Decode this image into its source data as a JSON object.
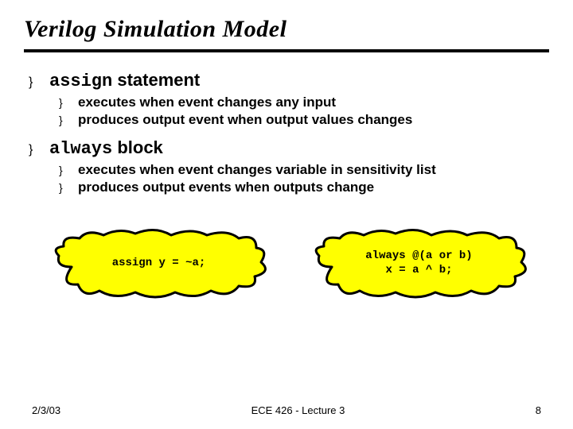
{
  "title": "Verilog Simulation Model",
  "bullets": [
    {
      "keyword": "assign",
      "rest": " statement",
      "sub": [
        "executes when event changes any input",
        "produces output event when output values changes"
      ]
    },
    {
      "keyword": "always",
      "rest": " block",
      "sub": [
        "executes when event changes variable in sensitivity list",
        "produces output events when outputs change"
      ]
    }
  ],
  "blob1": "assign y = ~a;",
  "blob2_l1": "always @(a or b)",
  "blob2_l2": "x = a ^ b;",
  "footer": {
    "date": "2/3/03",
    "center": "ECE 426 - Lecture 3",
    "page": "8"
  },
  "glyph": "}"
}
